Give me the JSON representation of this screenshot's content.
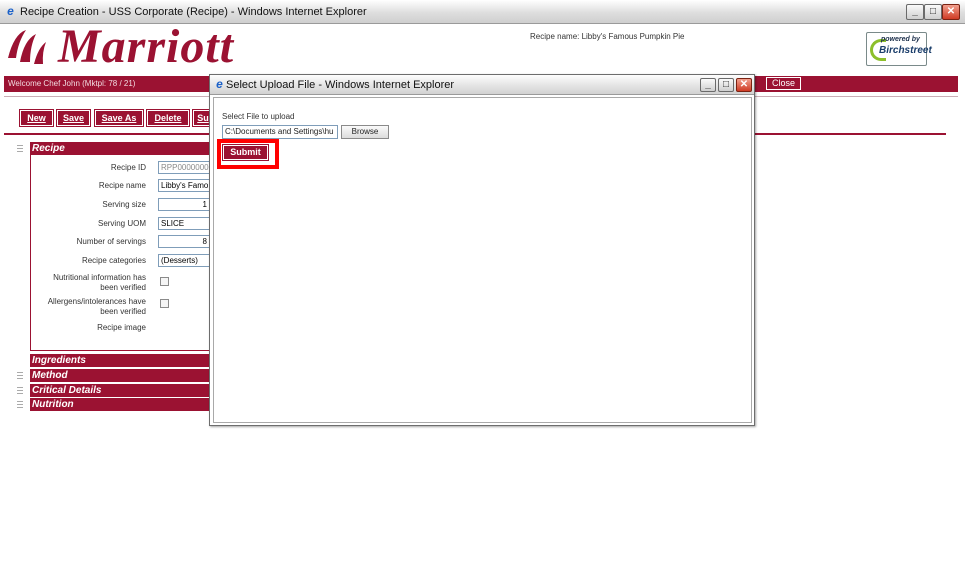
{
  "window": {
    "title": "Recipe Creation - USS Corporate (Recipe) - Windows Internet Explorer"
  },
  "header": {
    "brand": "Marriott",
    "recipe_name_label": "Recipe name: Libby's Famous Pumpkin Pie",
    "powered_by": "powered by",
    "partner_logo": "Birchstreet",
    "welcome": "Welcome Chef John (Mktpl: 78 / 21)",
    "close_label": "Close"
  },
  "toolbar": {
    "buttons": [
      "New",
      "Save",
      "Save As",
      "Delete",
      "Su"
    ]
  },
  "sections": {
    "recipe": "Recipe",
    "ingredients": "Ingredients",
    "method": "Method",
    "critical": "Critical Details",
    "nutrition": "Nutrition"
  },
  "form": {
    "recipe_id": {
      "label": "Recipe ID",
      "value": "RPP00000000"
    },
    "recipe_name": {
      "label": "Recipe name",
      "value": "Libby's Famo"
    },
    "serving_size": {
      "label": "Serving size",
      "value": "1"
    },
    "serving_uom": {
      "label": "Serving UOM",
      "value": "SLICE"
    },
    "num_servings": {
      "label": "Number of servings",
      "value": "8"
    },
    "category": {
      "label": "Recipe categories",
      "value": "(Desserts)"
    },
    "nutritional_1": "Nutritional information has",
    "nutritional_2": "been verified",
    "allergens_1": "Allergens/intolerances have",
    "allergens_2": "been verified",
    "recipe_image": "Recipe image"
  },
  "popup": {
    "title": "Select Upload File - Windows Internet Explorer",
    "upload_label": "Select File to upload",
    "file_value": "C:\\Documents and Settings\\hu",
    "browse_label": "Browse",
    "submit_label": "Submit"
  },
  "colors": {
    "brand": "#9b1232",
    "highlight": "#ff0000"
  }
}
